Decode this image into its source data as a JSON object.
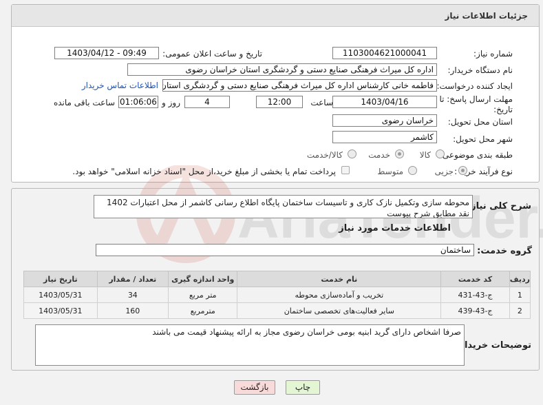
{
  "header": {
    "title": "جزئیات اطلاعات نیاز"
  },
  "fields": {
    "need_number_label": "شماره نیاز:",
    "need_number": "1103004621000041",
    "announce_label": "تاریخ و ساعت اعلان عمومی:",
    "announce_value": "1403/04/12 - 09:49",
    "buyer_org_label": "نام دستگاه خریدار:",
    "buyer_org": "اداره کل میراث فرهنگی  صنایع دستی و گردشگری استان خراسان رضوی",
    "creator_label": "ایجاد کننده درخواست:",
    "creator": "فاطمه خانی کارشناس اداره کل میراث فرهنگی  صنایع دستی و گردشگری استان خراسان رضوی",
    "contact_link": "اطلاعات تماس خریدار",
    "deadline_label_1": "مهلت ارسال پاسخ: تا",
    "deadline_label_2": "تاریخ:",
    "deadline_date": "1403/04/16",
    "time_label": "ساعت",
    "deadline_time": "12:00",
    "days_value": "4",
    "days_label": "روز و",
    "remaining_value": "01:06:06",
    "remaining_label": "ساعت باقی مانده",
    "province_label": "استان محل تحویل:",
    "province": "خراسان رضوی",
    "city_label": "شهر محل تحویل:",
    "city": "کاشمر",
    "category_label": "طبقه بندی موضوعی:",
    "category_options": [
      "کالا",
      "خدمت",
      "کالا/خدمت"
    ],
    "category_selected": "خدمت",
    "process_label": "نوع فرآیند خرید :",
    "process_options": [
      "جزیی",
      "متوسط"
    ],
    "process_selected": "جزیی",
    "payment_note": "پرداخت تمام یا بخشی از مبلغ خرید،از محل \"اسناد خزانه اسلامی\" خواهد بود."
  },
  "summary": {
    "label": "شرح کلی نیاز:",
    "text": "محوطه سازی وتکمیل نازک کاری و تاسیسات ساختمان پایگاه اطلاع رسانی کاشمر از محل اعتبارات 1402 نقد مطابق شرح پیوست"
  },
  "services": {
    "section_title": "اطلاعات خدمات مورد نیاز",
    "group_label": "گروه خدمت:",
    "group_value": "ساختمان",
    "columns": [
      "ردیف",
      "کد خدمت",
      "نام خدمت",
      "واحد اندازه گیری",
      "تعداد / مقدار",
      "تاریخ نیاز"
    ],
    "rows": [
      [
        "1",
        "ج-43-431",
        "تخریب و آماده‌سازی محوطه",
        "متر مربع",
        "34",
        "1403/05/31"
      ],
      [
        "2",
        "ج-43-439",
        "سایر فعالیت‌های تخصصی ساختمان",
        "مترمربع",
        "160",
        "1403/05/31"
      ]
    ]
  },
  "buyer_notes": {
    "label": "توضیحات خریدار:",
    "text": "صرفا اشخاص دارای گرید ابنیه بومی خراسان رضوی مجاز به ارائه پیشنهاد قیمت می باشند"
  },
  "buttons": {
    "print": "چاپ",
    "back": "بازگشت"
  },
  "watermark": {
    "text": "AriaTender.neT"
  },
  "colors": {
    "link": "#1a55b5",
    "print_bg": "#e4f5d4",
    "back_bg": "#f9dada"
  }
}
